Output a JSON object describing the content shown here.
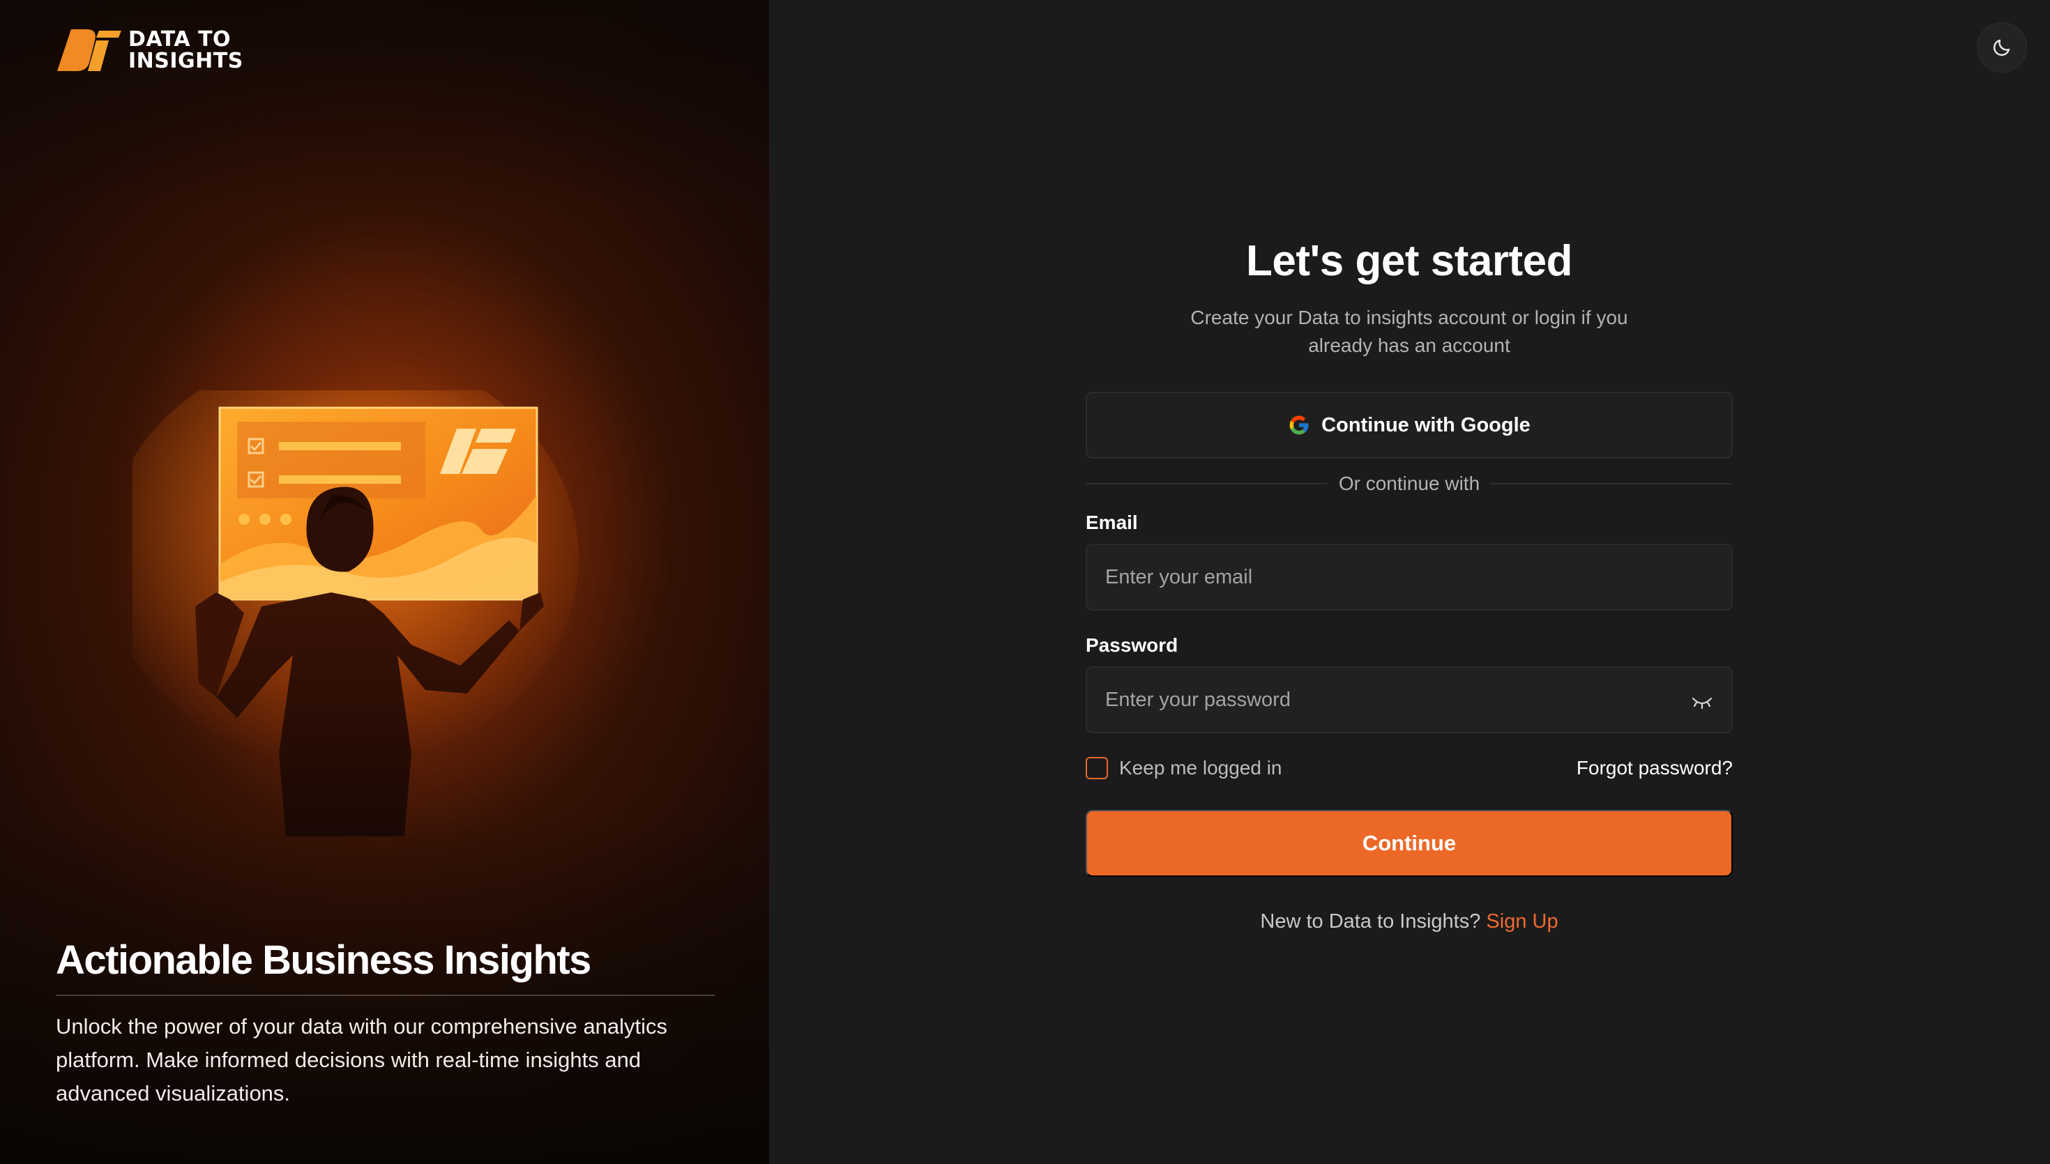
{
  "brand": {
    "line1": "DATA TO",
    "line2": "INSIGHTS",
    "mark_color": "#f08a24"
  },
  "hero": {
    "title": "Actionable Business Insights",
    "description": "Unlock the power of your data with our comprehensive analytics platform. Make informed decisions with real-time insights and advanced visualizations."
  },
  "theme_toggle": {
    "icon": "moon-icon"
  },
  "auth": {
    "title": "Let's get started",
    "subtitle": "Create your Data to insights account or login if you already has an account",
    "google_button": "Continue with Google",
    "divider": "Or continue with",
    "email": {
      "label": "Email",
      "placeholder": "Enter your email",
      "value": ""
    },
    "password": {
      "label": "Password",
      "placeholder": "Enter your password",
      "value": ""
    },
    "remember_label": "Keep me logged in",
    "remember_checked": false,
    "forgot_link": "Forgot password?",
    "continue_button": "Continue",
    "signup_prompt": "New to Data to Insights?",
    "signup_link": "Sign Up"
  },
  "colors": {
    "accent": "#ec6827",
    "panel_background": "#1b1b1b",
    "input_background": "#212121"
  }
}
